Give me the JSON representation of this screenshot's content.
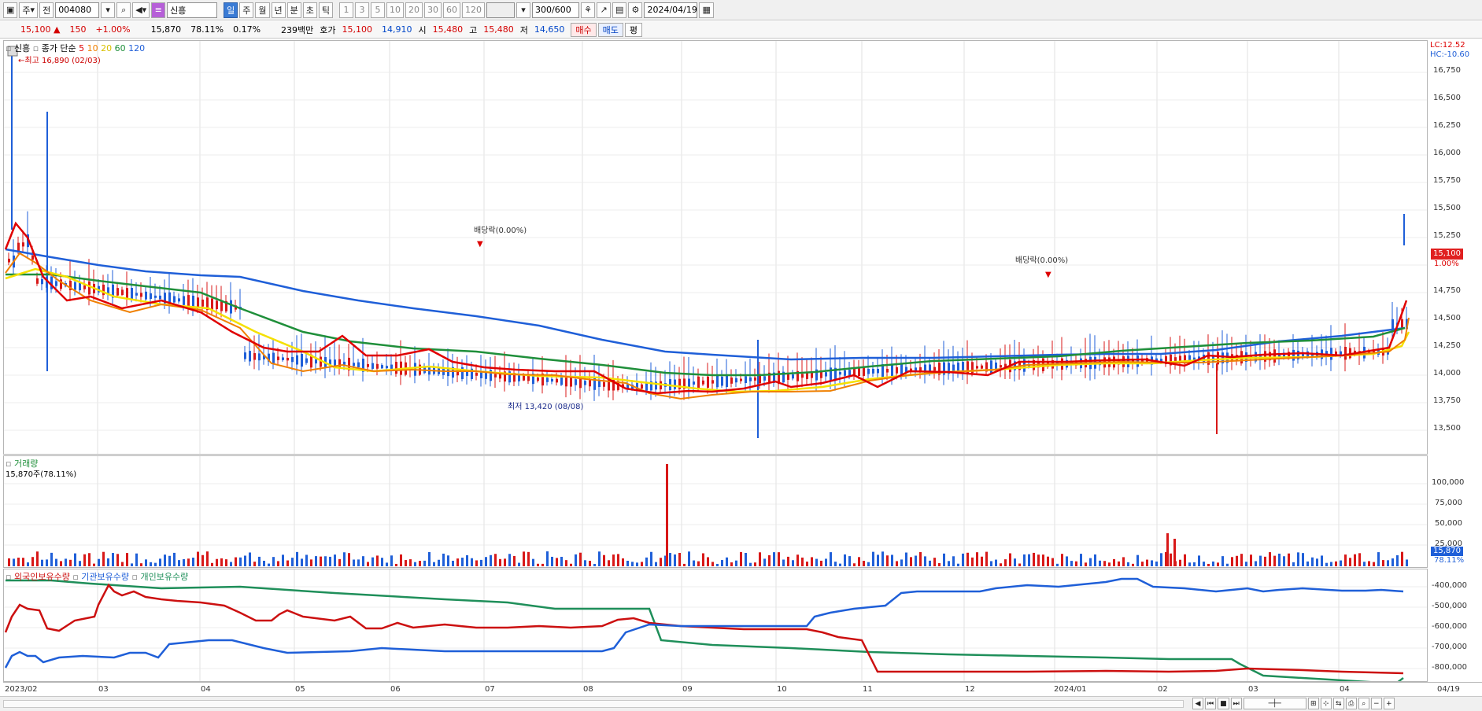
{
  "toolbar": {
    "market_label": "주",
    "category_label": "전",
    "code_value": "004080",
    "name_value": "신흥",
    "period_tabs": [
      "일",
      "주",
      "월",
      "년",
      "분",
      "초",
      "틱"
    ],
    "active_period": "일",
    "interval_tabs": [
      "1",
      "3",
      "5",
      "10",
      "20",
      "30",
      "60",
      "120"
    ],
    "count_value": "300/600",
    "date_value": "2024/04/19"
  },
  "quote": {
    "price": "15,100",
    "change_arrow": "▲",
    "change": "150",
    "change_pct": "+1.00%",
    "volume": "15,870",
    "volume_ratio": "78.11%",
    "turnover": "0.17%",
    "amount": "239백만",
    "ask_label": "호가",
    "ask_up": "15,100",
    "ask_down": "14,910",
    "open_label": "시",
    "open": "15,480",
    "high_label": "고",
    "high": "15,480",
    "low_label": "저",
    "low": "14,650",
    "buy_label": "매수",
    "sell_label": "매도",
    "eval_label": "평"
  },
  "price_pane": {
    "stock_name": "신흥",
    "legend_type": "종가 단순",
    "ma_legend": [
      "5",
      "10",
      "20",
      "60",
      "120"
    ],
    "ma_colors": [
      "#e00000",
      "#f08000",
      "#f5e000",
      "#1f8f3a",
      "#1f5fd8"
    ],
    "high_marker": "←최고 16,890 (02/03)",
    "low_marker": "최저 13,420 (08/08)",
    "dividend_1": "배당락(0.00%)",
    "dividend_2": "배당락(0.00%)",
    "lc_label": "LC:12.52",
    "hc_label": "HC:-10.60",
    "y_ticks": [
      "16,750",
      "16,500",
      "16,250",
      "16,000",
      "15,750",
      "15,500",
      "15,250",
      "15,100",
      "14,750",
      "14,500",
      "14,250",
      "14,000",
      "13,750",
      "13,500"
    ],
    "current_tag": "15,100",
    "current_pct": "1.00%"
  },
  "volume_pane": {
    "title": "거래량",
    "subtitle": "15,870주(78.11%)",
    "y_ticks": [
      "100,000",
      "75,000",
      "50,000",
      "25,000"
    ],
    "current_tag": "15,870",
    "current_pct": "78.11%"
  },
  "holding_pane": {
    "legend": [
      "외국인보유수량",
      "기관보유수량",
      "개인보유수량"
    ],
    "legend_colors": [
      "#cc1010",
      "#1f5fd8",
      "#1f8f5a"
    ],
    "y_ticks": [
      "-400,000",
      "-500,000",
      "-600,000",
      "-700,000",
      "-800,000"
    ]
  },
  "x_axis": [
    "2023/02",
    "03",
    "04",
    "05",
    "06",
    "07",
    "08",
    "09",
    "10",
    "11",
    "12",
    "2024/01",
    "02",
    "03",
    "04",
    "04/19"
  ]
}
